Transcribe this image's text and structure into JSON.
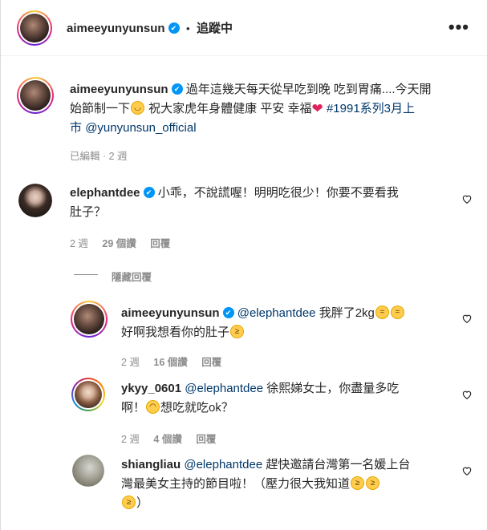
{
  "header": {
    "username": "aimeeyunyunsun",
    "separator": "•",
    "follow_status": "追蹤中",
    "more_icon": "more-horizontal-icon"
  },
  "caption": {
    "username": "aimeeyunyunsun",
    "line1_text": "過年這幾天每天從早吃到晚 吃到胃痛....今天開",
    "line2_text_a": "始節制一下",
    "line2_text_b": " 祝大家虎年身體健康 平安 幸福",
    "hashtag": "#1991系列3月上",
    "line3_hashtag_end": "市",
    "mention": "@yunyunsun_official",
    "meta_edited": "已編輯 · 2 週"
  },
  "comments": [
    {
      "username": "elephantdee",
      "text_line1": "小乖，不說謊喔！明明吃很少！你要不要看我",
      "text_line2": "肚子？",
      "meta_time": "2 週",
      "meta_likes": "29 個讚",
      "meta_reply": "回覆"
    }
  ],
  "hide_replies": "隱藏回覆",
  "replies": [
    {
      "username": "aimeeyunyunsun",
      "mention": "@elephantdee",
      "text_a": " 我胖了2kg",
      "text_line2": "好啊我想看你的肚子",
      "meta_time": "2 週",
      "meta_likes": "16 個讚",
      "meta_reply": "回覆"
    },
    {
      "username": "ykyy_0601",
      "mention": "@elephantdee",
      "text_a": " 徐熙娣女士，你盡量多吃",
      "text_line2_a": "啊！",
      "text_line2_b": "想吃就吃ok？",
      "meta_time": "2 週",
      "meta_likes": "4 個讚",
      "meta_reply": "回覆"
    },
    {
      "username": "shiangliau",
      "mention": "@elephantdee",
      "text_a": " 趕快邀請台灣第一名媛上台",
      "text_line2": "灣最美女主持的節目啦！（壓力很大我知道",
      "text_line3": "）"
    }
  ]
}
